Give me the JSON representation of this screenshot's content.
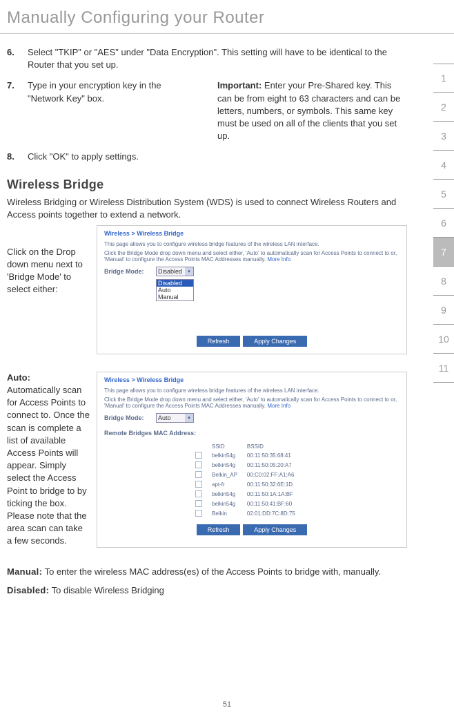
{
  "title": "Manually Configuring your Router",
  "pageNumber": "51",
  "sideTabs": [
    "1",
    "2",
    "3",
    "4",
    "5",
    "6",
    "7",
    "8",
    "9",
    "10",
    "11"
  ],
  "activeTab": "7",
  "steps": {
    "s6": {
      "num": "6.",
      "text": "Select \"TKIP\" or \"AES\" under \"Data Encryption\". This setting will have to be identical to the Router that you set up."
    },
    "s7": {
      "num": "7.",
      "text": "Type in your encryption key in the \"Network Key\" box."
    },
    "s8": {
      "num": "8.",
      "text": "Click \"OK\" to apply settings."
    }
  },
  "importantLabel": "Important:",
  "importantText": " Enter your Pre-Shared key. This can be from eight to 63 characters and can be letters, numbers, or symbols. This same key must be used on all of the clients that you set up.",
  "wbHeading": "Wireless Bridge",
  "wbIntro": "Wireless Bridging or Wireless Distribution System (WDS) is used to connect Wireless Routers and Access points together to extend a network.",
  "dropText": "Click on the Drop down menu next to 'Bridge Mode' to select either:",
  "autoLabel": "Auto:",
  "autoText": "Automatically scan for Access Points to connect to. Once the scan is complete a list of available Access Points will appear. Simply select the Access Point to bridge to by ticking the box. Please note that the area scan can take a few seconds.",
  "manualLabel": "Manual:",
  "manualText": " To enter the wireless MAC address(es) of the Access Points to bridge with, manually.",
  "disabledLabel": "Disabled:",
  "disabledText": " To disable Wireless Bridging",
  "ss": {
    "breadcrumb": "Wireless > Wireless Bridge",
    "desc": "This page allows you to configure wireless bridge features of the wireless LAN interface.",
    "desc2a": "Click the Bridge Mode drop down menu and select either, 'Auto' to automatically scan for Access Points to connect to or, 'Manual' to configure the Access Points MAC Addresses manually. ",
    "moreInfo": "More Info",
    "bridgeModeLabel": "Bridge Mode:",
    "bridgeModeVal1": "Disabled",
    "dropdownItems": [
      "Disabled",
      "Auto",
      "Manual"
    ],
    "bridgeModeVal2": "Auto",
    "refreshBtn": "Refresh",
    "applyBtn": "Apply Changes",
    "remoteLabel": "Remote Bridges MAC Address:",
    "tableHeaders": [
      "SSID",
      "BSSID"
    ],
    "tableRows": [
      {
        "ssid": "belkin54g",
        "bssid": "00:11:50:35:68:41"
      },
      {
        "ssid": "belkin54g",
        "bssid": "00:11:50:05:20:A7"
      },
      {
        "ssid": "Belkin_AP",
        "bssid": "00:C0:02:FF:A1:A6"
      },
      {
        "ssid": "apt-fr",
        "bssid": "00:11:50:32:6E:1D"
      },
      {
        "ssid": "belkin54g",
        "bssid": "00:11:50:1A:1A:BF"
      },
      {
        "ssid": "belkin54g",
        "bssid": "00:11:50:41:BF:60"
      },
      {
        "ssid": "Belkin",
        "bssid": "02:01:DD:7C:8D:75"
      }
    ]
  }
}
